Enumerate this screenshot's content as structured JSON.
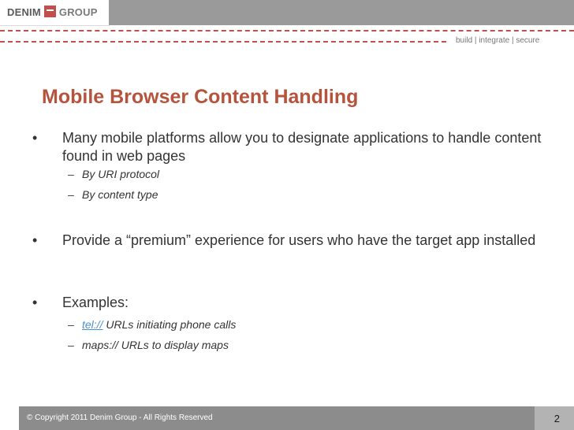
{
  "header": {
    "logo_word1": "DENIM",
    "logo_word2": "GROUP",
    "tagline": "build  |  integrate  |  secure",
    "accent_color": "#c0504d"
  },
  "slide": {
    "title": "Mobile Browser Content Handling",
    "title_color": "#b5533c",
    "bullets": [
      {
        "text": "Many mobile platforms allow you to designate applications to handle content found in web pages"
      },
      {
        "text": "Provide a “premium” experience for users who have the target app installed"
      },
      {
        "text": "Examples:"
      }
    ],
    "sub_bullets_1": [
      "By URI protocol",
      "By content type"
    ],
    "sub_bullets_3": [
      {
        "link": "tel://",
        "rest": " URLs initiating phone calls"
      },
      {
        "text": "maps://  URLs to display maps"
      }
    ],
    "bullet_char": "•",
    "sub_char": "–"
  },
  "footer": {
    "copyright": "© Copyright 2011 Denim Group - All Rights Reserved",
    "page_number": "2"
  }
}
